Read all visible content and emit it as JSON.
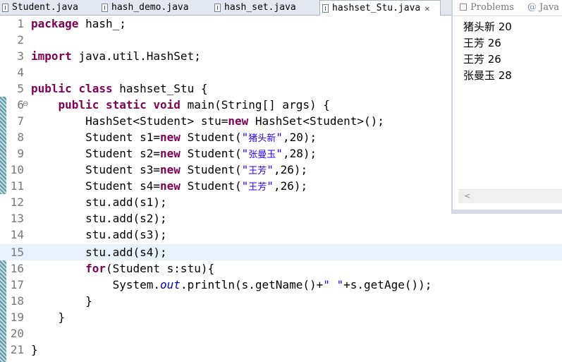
{
  "editor_tabs": [
    {
      "label": "Student.java",
      "active": false
    },
    {
      "label": "hash_demo.java",
      "active": false
    },
    {
      "label": "hash_set.java",
      "active": false
    },
    {
      "label": "hashset_Stu.java",
      "active": true
    }
  ],
  "view_tabs": {
    "problems": "Problems",
    "javadoc": "Java"
  },
  "console_output": [
    "猪头新 20",
    "王芳 26",
    "王芳 26",
    "张曼玉 28"
  ],
  "line_numbers": [
    "1",
    "2",
    "3",
    "4",
    "5",
    "6",
    "7",
    "8",
    "9",
    "10",
    "11",
    "12",
    "13",
    "14",
    "15",
    "16",
    "17",
    "18",
    "19",
    "20",
    "21"
  ],
  "code": {
    "l1": {
      "kw": "package",
      "rest": " hash_;"
    },
    "l3": {
      "kw": "import",
      "rest": " java.util.HashSet;"
    },
    "l5": {
      "kw1": "public",
      "kw2": "class",
      "rest": " hashset_Stu {"
    },
    "l6": {
      "kw1": "public",
      "kw2": "static",
      "kw3": "void",
      "rest": " main(String[] args) {"
    },
    "l7": {
      "a": "HashSet<Student> stu=",
      "kw": "new",
      "b": " HashSet<Student>();"
    },
    "l8": {
      "a": "Student s1=",
      "kw": "new",
      "b": " Student(",
      "s1": "\"",
      "cn": "猪头新",
      "s2": "\"",
      "c": ",20);"
    },
    "l9": {
      "a": "Student s2=",
      "kw": "new",
      "b": " Student(",
      "s1": "\"",
      "cn": "张曼玉",
      "s2": "\"",
      "c": ",28);"
    },
    "l10": {
      "a": "Student s3=",
      "kw": "new",
      "b": " Student(",
      "s1": "\"",
      "cn": "王芳",
      "s2": "\"",
      "c": ",26);"
    },
    "l11": {
      "a": "Student s4=",
      "kw": "new",
      "b": " Student(",
      "s1": "\"",
      "cn": "王芳",
      "s2": "\"",
      "c": ",26);"
    },
    "l12": "stu.add(s1);",
    "l13": "stu.add(s2);",
    "l14": "stu.add(s3);",
    "l15": "stu.add(s4);",
    "l16": {
      "kw": "for",
      "rest": "(Student s:stu){"
    },
    "l17": {
      "a": "System.",
      "fld": "out",
      "b": ".println(s.getName()+",
      "str": "\" \"",
      "c": "+s.getAge());"
    },
    "l18": "}",
    "l19": "}",
    "l21": "}"
  }
}
